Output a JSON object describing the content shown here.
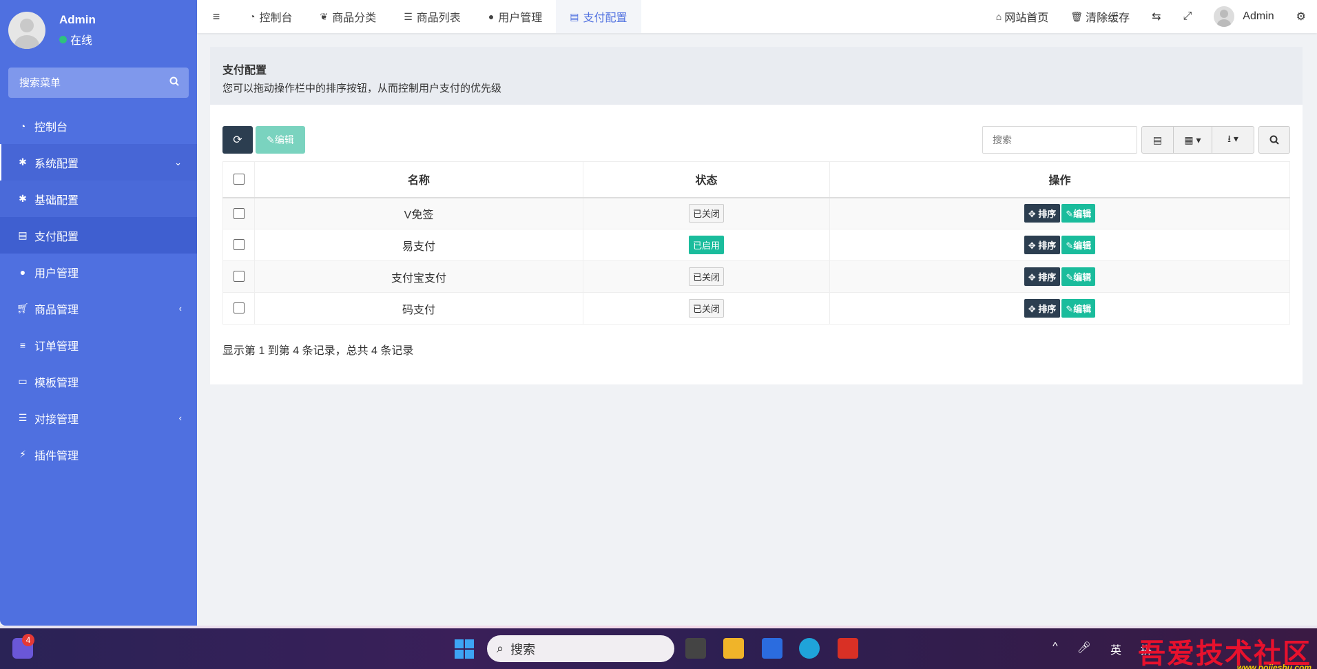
{
  "sidebar": {
    "user_name": "Admin",
    "user_status": "在线",
    "search_placeholder": "搜索菜单",
    "items": [
      {
        "label": "控制台",
        "icon": "dashboard-icon"
      },
      {
        "label": "系统配置",
        "icon": "gear-icon"
      },
      {
        "label": "基础配置",
        "icon": "gear-icon"
      },
      {
        "label": "支付配置",
        "icon": "credit-card-icon"
      },
      {
        "label": "用户管理",
        "icon": "user-icon"
      },
      {
        "label": "商品管理",
        "icon": "cart-icon"
      },
      {
        "label": "订单管理",
        "icon": "list-icon"
      },
      {
        "label": "模板管理",
        "icon": "template-icon"
      },
      {
        "label": "对接管理",
        "icon": "sliders-icon"
      },
      {
        "label": "插件管理",
        "icon": "plug-icon"
      }
    ]
  },
  "topbar": {
    "tabs": [
      {
        "label": "控制台",
        "icon": "dashboard-icon"
      },
      {
        "label": "商品分类",
        "icon": "leaf-icon"
      },
      {
        "label": "商品列表",
        "icon": "list-icon"
      },
      {
        "label": "用户管理",
        "icon": "user-icon"
      },
      {
        "label": "支付配置",
        "icon": "credit-card-icon"
      }
    ],
    "home_label": "网站首页",
    "clear_cache_label": "清除缓存",
    "user_name": "Admin"
  },
  "panel": {
    "title": "支付配置",
    "description": "您可以拖动操作栏中的排序按钮，从而控制用户支付的优先级",
    "edit_label": "编辑",
    "search_placeholder": "搜索",
    "columns": [
      "名称",
      "状态",
      "操作"
    ],
    "rows": [
      {
        "name": "V免签",
        "status": "已关闭",
        "enabled": false
      },
      {
        "name": "易支付",
        "status": "已启用",
        "enabled": true
      },
      {
        "name": "支付宝支付",
        "status": "已关闭",
        "enabled": false
      },
      {
        "name": "码支付",
        "status": "已关闭",
        "enabled": false
      }
    ],
    "sort_label": "排序",
    "row_edit_label": "编辑",
    "pager_info": "显示第 1 到第 4 条记录，总共 4 条记录"
  },
  "taskbar": {
    "notif_count": "4",
    "search_label": "搜索",
    "ime_en": "英",
    "ime_pin": "拼"
  },
  "watermark": {
    "text": "吾爱技术社区",
    "url": "www.pojieshu.com"
  },
  "colors": {
    "sidebar": "#4f70e0",
    "dark_button": "#2c3e50",
    "green": "#1abc9c"
  }
}
